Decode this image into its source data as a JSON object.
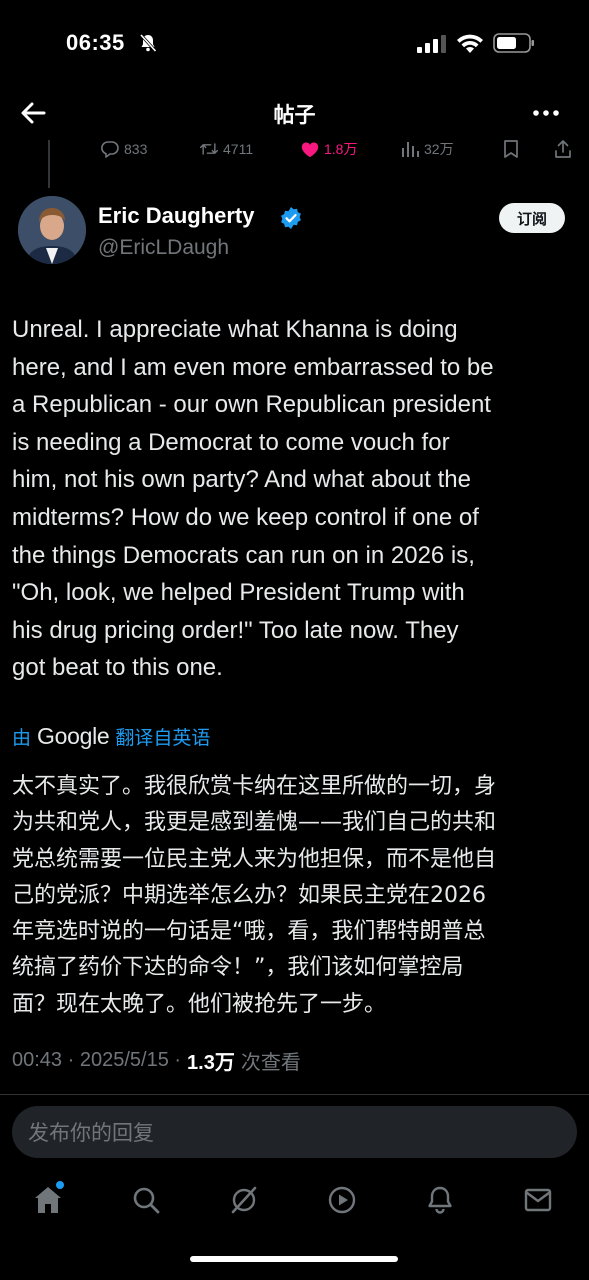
{
  "status_bar": {
    "time": "06:35"
  },
  "header": {
    "title": "帖子"
  },
  "parent_actions": {
    "replies": "833",
    "reposts": "4711",
    "likes": "1.8万",
    "views": "32万"
  },
  "author": {
    "name": "Eric Daugherty",
    "handle": "@EricLDaugh",
    "subscribe_label": "订阅"
  },
  "tweet": {
    "text": "Unreal. I appreciate what Khanna is doing\nhere, and I am even more embarrassed to be\na Republican - our own Republican president\nis needing a Democrat to come vouch for\nhim, not his own party? And what about the\nmidterms? How do we keep control if one of\nthe things Democrats can run on in 2026 is,\n\"Oh, look, we helped President Trump with\nhis drug pricing order!\" Too late now. They\ngot beat to this one."
  },
  "translation": {
    "prefix": "由",
    "provider": "Google",
    "suffix": "翻译自英语",
    "text": "太不真实了。我很欣赏卡纳在这里所做的一切，身\n为共和党人，我更是感到羞愧——我们自己的共和\n党总统需要一位民主党人来为他担保，而不是他自\n己的党派？中期选举怎么办？如果民主党在2026\n年竞选时说的一句话是“哦，看，我们帮特朗普总\n统搞了药价下达的命令！”，我们该如何掌控局\n面？现在太晚了。他们被抢先了一步。"
  },
  "meta": {
    "time": "00:43",
    "date": "2025/5/15",
    "views": "1.3万",
    "views_label": "次查看"
  },
  "reply": {
    "placeholder": "发布你的回复"
  },
  "colors": {
    "accent": "#1d9bf0",
    "like": "#f91880",
    "muted": "#71767b",
    "background": "#000000"
  },
  "icons": {
    "status": [
      "bell-slash-icon",
      "signal-icon",
      "wifi-icon",
      "battery-icon"
    ],
    "header": [
      "back-arrow-icon",
      "more-icon"
    ],
    "actions": [
      "reply-icon",
      "repost-icon",
      "like-icon",
      "views-icon",
      "bookmark-icon",
      "share-icon"
    ],
    "nav": [
      "home-icon",
      "search-icon",
      "grok-icon",
      "video-icon",
      "notifications-icon",
      "messages-icon"
    ]
  }
}
